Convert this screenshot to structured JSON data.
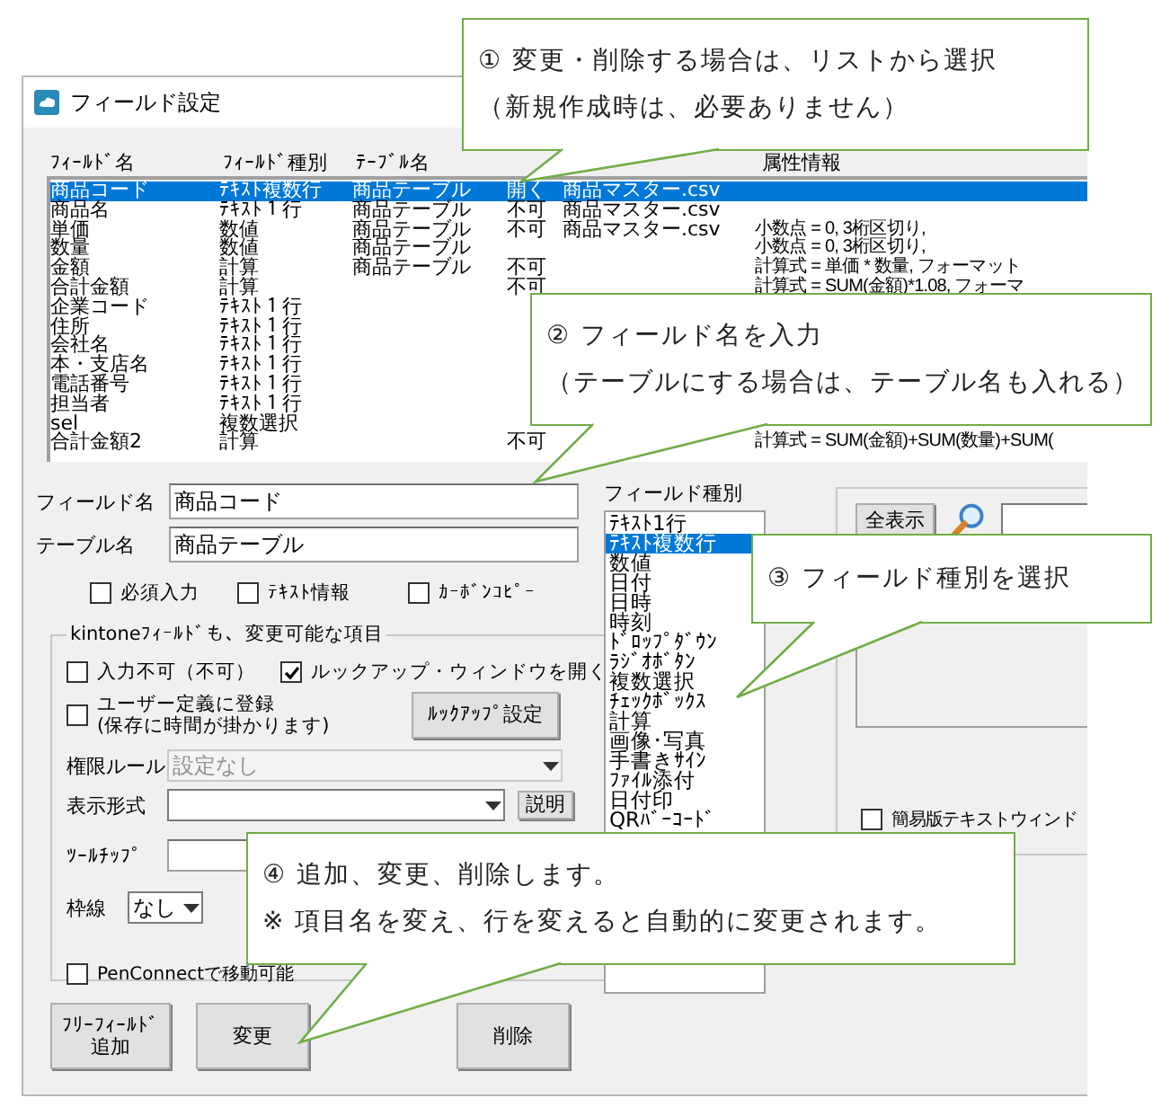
{
  "window": {
    "title": "フィールド設定"
  },
  "field_list": {
    "headers": {
      "name": "ﾌｨｰﾙﾄﾞ名",
      "type": "ﾌｨｰﾙﾄﾞ種別",
      "table": "ﾃｰﾌﾞﾙ名",
      "attributes": "属性情報"
    },
    "rows": [
      {
        "name": "商品コード",
        "type": "ﾃｷｽﾄ複数行",
        "table": "商品テーブル",
        "column_4": "開く",
        "column_5": "商品マスター.csv",
        "selected": true
      },
      {
        "name": "商品名",
        "type": "ﾃｷｽﾄ１行",
        "table": "商品テーブル",
        "column_4": "不可",
        "column_5": "商品マスター.csv",
        "selected": false
      },
      {
        "name": "単価",
        "type": "数値",
        "table": "商品テーブル",
        "column_4": "不可",
        "column_5": "商品マスター.csv",
        "attributes": "小数点 = 0, 3桁区切り,",
        "selected": false
      },
      {
        "name": "数量",
        "type": "数値",
        "table": "商品テーブル",
        "attributes": "小数点 = 0, 3桁区切り,",
        "selected": false
      },
      {
        "name": "金額",
        "type": "計算",
        "table": "商品テーブル",
        "column_4": "不可",
        "attributes": "計算式 = 単価 * 数量, フォーマット",
        "selected": false
      },
      {
        "name": "合計金額",
        "type": "計算",
        "column_4": "不可",
        "attributes": "計算式 = SUM(金額)*1.08, フォーマ",
        "selected": false
      },
      {
        "name": "企業コード",
        "type": "ﾃｷｽﾄ１行",
        "selected": false
      },
      {
        "name": "住所",
        "type": "ﾃｷｽﾄ１行",
        "selected": false
      },
      {
        "name": "会社名",
        "type": "ﾃｷｽﾄ１行",
        "selected": false
      },
      {
        "name": "本・支店名",
        "type": "ﾃｷｽﾄ１行",
        "selected": false
      },
      {
        "name": "電話番号",
        "type": "ﾃｷｽﾄ１行",
        "selected": false
      },
      {
        "name": "担当者",
        "type": "ﾃｷｽﾄ１行",
        "selected": false
      },
      {
        "name": "sel",
        "type": "複数選択",
        "selected": false
      },
      {
        "name": "合計金額2",
        "type": "計算",
        "column_4": "不可",
        "attributes": "計算式 = SUM(金額)+SUM(数量)+SUM(",
        "selected": false
      }
    ]
  },
  "form": {
    "field_name": {
      "label": "フィールド名",
      "value": "商品コード"
    },
    "table_name": {
      "label": "テーブル名",
      "value": "商品テーブル"
    },
    "options": [
      {
        "label": "必須入力",
        "checked": false
      },
      {
        "label": "ﾃｷｽﾄ情報",
        "checked": false
      },
      {
        "label": "ｶｰﾎﾞﾝｺﾋﾟｰ",
        "checked": false
      }
    ],
    "group": {
      "title": "kintoneﾌｨｰﾙﾄﾞも、変更可能な項目",
      "read_only": {
        "label": "入力不可（不可）",
        "checked": false
      },
      "lookup_window": {
        "label": "ルックアップ・ウィンドウを開く",
        "checked": true
      },
      "user_defined": {
        "label": "ユーザー定義に登録",
        "note": "(保存に時間が掛かります)",
        "checked": false
      },
      "lookup_button": "ﾙｯｸｱｯﾌﾟ設定",
      "permission": {
        "label": "権限ルール",
        "value": "設定なし",
        "disabled": true
      },
      "display_format": {
        "label": "表示形式",
        "button": "説明",
        "disabled": false
      },
      "tooltip": {
        "label": "ﾂｰﾙﾁｯﾌﾟ"
      },
      "border": {
        "label": "枠線",
        "value": "なし"
      },
      "pen_connect": {
        "label": "PenConnectで移動可能",
        "checked": false
      }
    }
  },
  "buttons": [
    {
      "lines": [
        "ﾌﾘｰﾌｨｰﾙﾄﾞ",
        "追加"
      ]
    },
    {
      "lines": [
        "変更"
      ]
    },
    {
      "lines": [
        "削除"
      ]
    }
  ],
  "field_types": {
    "label": "フィールド種別",
    "items": [
      {
        "label": "ﾃｷｽﾄ1行",
        "selected": false
      },
      {
        "label": "ﾃｷｽﾄ複数行",
        "selected": true
      },
      {
        "label": "数値",
        "selected": false
      },
      {
        "label": "日付",
        "selected": false
      },
      {
        "label": "日時",
        "selected": false
      },
      {
        "label": "時刻",
        "selected": false
      },
      {
        "label": "ﾄﾞﾛｯﾌﾟﾀﾞｳﾝ",
        "selected": false
      },
      {
        "label": "ﾗｼﾞｵﾎﾞﾀﾝ",
        "selected": false
      },
      {
        "label": "複数選択",
        "selected": false
      },
      {
        "label": "ﾁｪｯｸﾎﾞｯｸｽ",
        "selected": false
      },
      {
        "label": "計算",
        "selected": false
      },
      {
        "label": "画像･写真",
        "selected": false
      },
      {
        "label": "手書きｻｲﾝ",
        "selected": false
      },
      {
        "label": "ﾌｧｲﾙ添付",
        "selected": false
      },
      {
        "label": "日付印",
        "selected": false
      },
      {
        "label": "QRﾊﾞｰｺｰﾄﾞ",
        "selected": false
      }
    ]
  },
  "right_panel": {
    "show_all_button": "全表示",
    "simple_text_window": {
      "label": "簡易版テキストウィンド",
      "checked": false
    }
  },
  "callouts": [
    {
      "lines": [
        "① 変更・削除する場合は、リストから選択",
        "（新規作成時は、必要ありません）"
      ]
    },
    {
      "lines": [
        "② フィールド名を入力",
        "（テーブルにする場合は、テーブル名も入れる）"
      ]
    },
    {
      "lines": [
        "③ フィールド種別を選択"
      ]
    },
    {
      "lines": [
        "④ 追加、変更、削除します。",
        "※ 項目名を変え、行を変えると自動的に変更されます。"
      ]
    }
  ]
}
